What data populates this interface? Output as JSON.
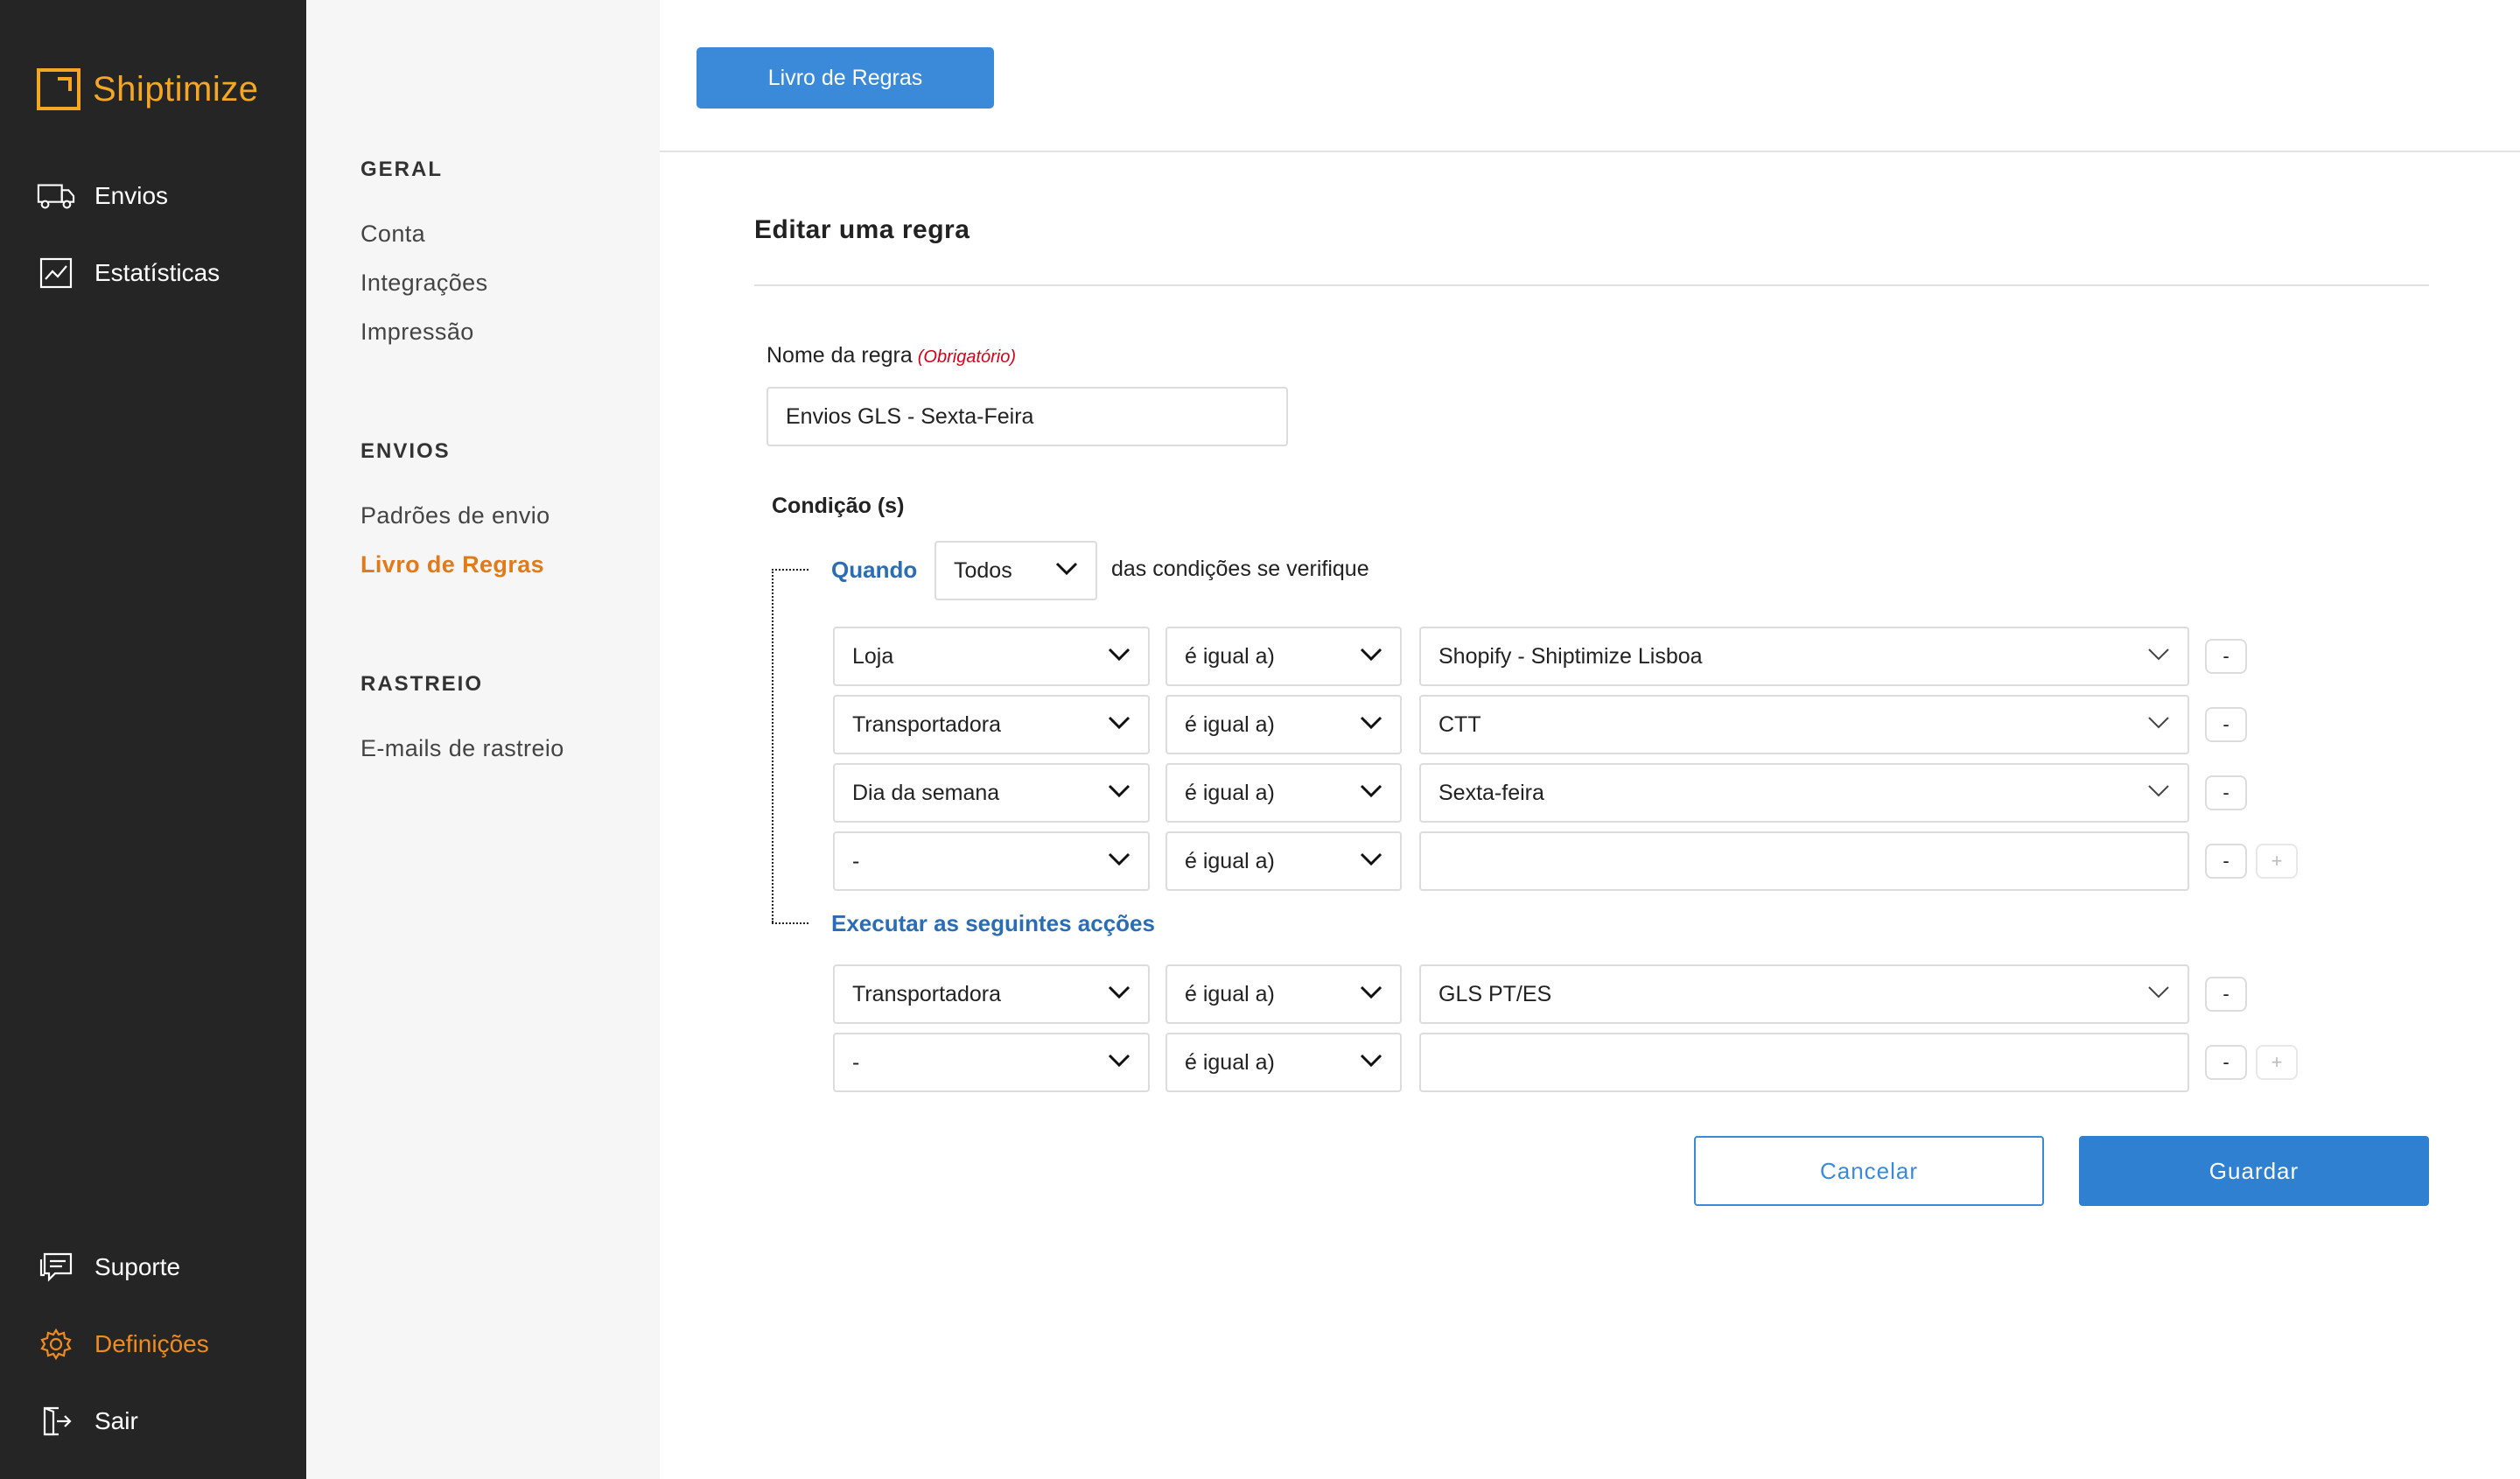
{
  "brand": {
    "name": "Shiptimize",
    "accent": "#f5a623"
  },
  "sidebar": {
    "items": [
      {
        "label": "Envios",
        "icon": "truck-icon"
      },
      {
        "label": "Estatísticas",
        "icon": "chart-icon"
      }
    ],
    "bottom_items": [
      {
        "label": "Suporte",
        "icon": "chat-icon"
      },
      {
        "label": "Definições",
        "icon": "gear-icon",
        "active": true
      },
      {
        "label": "Sair",
        "icon": "logout-icon"
      }
    ]
  },
  "subnav": {
    "sections": [
      {
        "title": "GERAL",
        "links": [
          "Conta",
          "Integrações",
          "Impressão"
        ]
      },
      {
        "title": "ENVIOS",
        "links": [
          "Padrões de envio",
          "Livro de Regras"
        ]
      },
      {
        "title": "RASTREIO",
        "links": [
          "E-mails de rastreio"
        ]
      }
    ],
    "active_link": "Livro de Regras"
  },
  "header": {
    "tab_label": "Livro de Regras"
  },
  "main": {
    "title": "Editar uma regra",
    "rule_name_label": "Nome da regra",
    "rule_name_required": "(Obrigatório)",
    "rule_name_value": "Envios GLS - Sexta-Feira",
    "conditions_title": "Condição (s)",
    "when_label": "Quando",
    "match_select": "Todos",
    "match_suffix": "das condições se verifique",
    "actions_label": "Executar as seguintes acções",
    "conditions": [
      {
        "field": "Loja",
        "operator": "é igual a)",
        "value": "Shopify - Shiptimize Lisboa"
      },
      {
        "field": "Transportadora",
        "operator": "é igual a)",
        "value": "CTT"
      },
      {
        "field": "Dia da semana",
        "operator": "é igual a)",
        "value": "Sexta-feira"
      },
      {
        "field": "-",
        "operator": "é igual a)",
        "value": ""
      }
    ],
    "actions": [
      {
        "field": "Transportadora",
        "operator": "é igual a)",
        "value": "GLS PT/ES"
      },
      {
        "field": "-",
        "operator": "é igual a)",
        "value": ""
      }
    ],
    "remove_label": "-",
    "add_label": "+",
    "cancel_label": "Cancelar",
    "save_label": "Guardar"
  },
  "colors": {
    "primary": "#2f80d0",
    "link": "#2a6db5",
    "active_nav": "#e07a1a",
    "required": "#d0021b"
  }
}
